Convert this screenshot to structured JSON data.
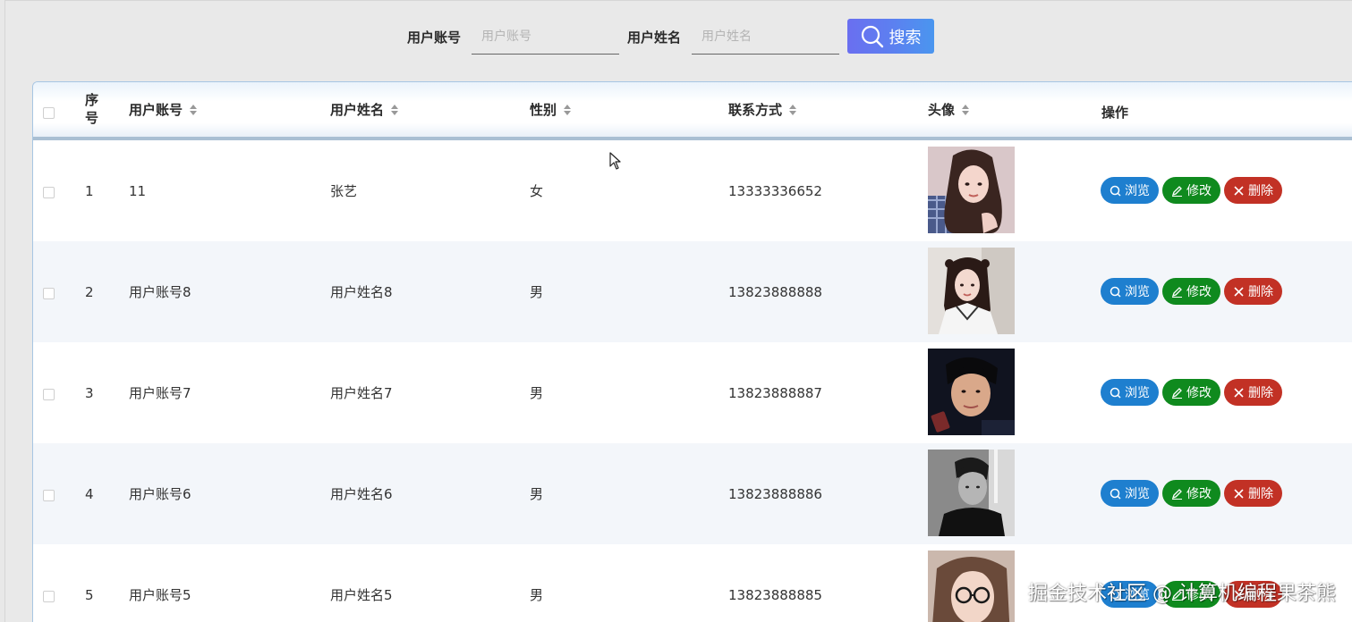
{
  "search": {
    "account_label": "用户账号",
    "account_placeholder": "用户账号",
    "name_label": "用户姓名",
    "name_placeholder": "用户姓名",
    "button_label": "搜索",
    "button_icon": "search-icon"
  },
  "table": {
    "headers": {
      "index": "序号",
      "account": "用户账号",
      "name": "用户姓名",
      "gender": "性别",
      "contact": "联系方式",
      "avatar": "头像",
      "actions": "操作"
    },
    "action_labels": {
      "view": "浏览",
      "edit": "修改",
      "delete": "删除"
    },
    "rows": [
      {
        "index": "1",
        "account": "11",
        "name": "张艺",
        "gender": "女",
        "contact": "13333336652"
      },
      {
        "index": "2",
        "account": "用户账号8",
        "name": "用户姓名8",
        "gender": "男",
        "contact": "13823888888"
      },
      {
        "index": "3",
        "account": "用户账号7",
        "name": "用户姓名7",
        "gender": "男",
        "contact": "13823888887"
      },
      {
        "index": "4",
        "account": "用户账号6",
        "name": "用户姓名6",
        "gender": "男",
        "contact": "13823888886"
      },
      {
        "index": "5",
        "account": "用户账号5",
        "name": "用户姓名5",
        "gender": "男",
        "contact": "13823888885"
      }
    ]
  },
  "colors": {
    "view_button": "#1e7fcf",
    "edit_button": "#0f8a1e",
    "delete_button": "#c23125",
    "search_button_start": "#6a6ff0",
    "search_button_end": "#4a96ef",
    "alt_row": "#f3f6fa"
  },
  "watermark": "掘金技术社区 @ 计算机编程果茶熊"
}
